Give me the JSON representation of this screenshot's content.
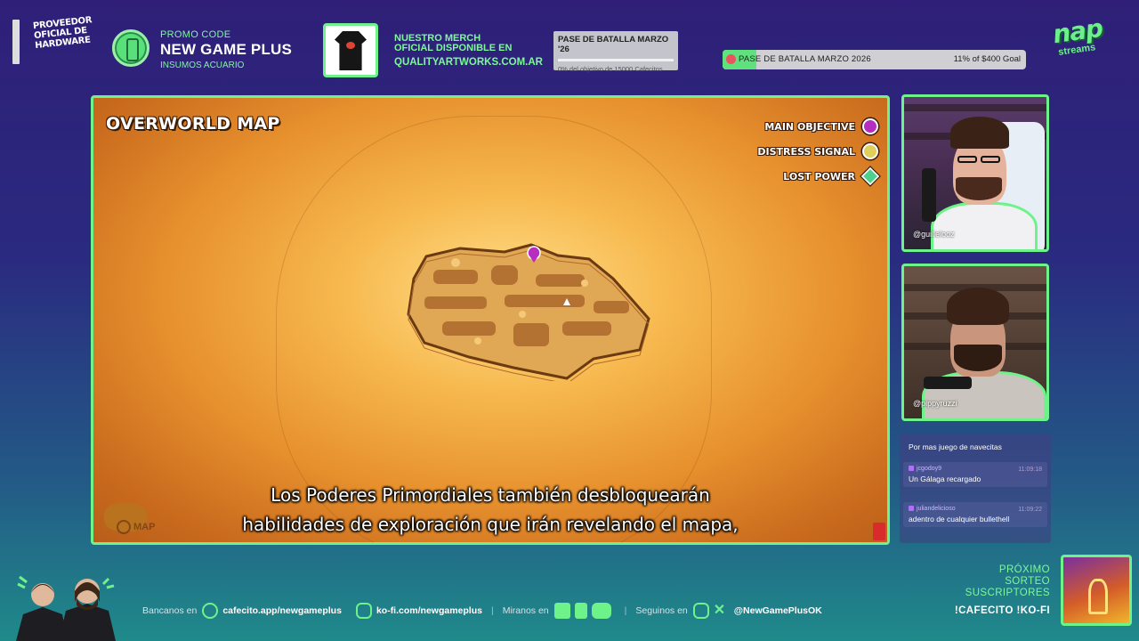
{
  "top": {
    "hardware_logo": "PROVEEDOR OFICIAL DE HARDWARE",
    "promo": {
      "label": "PROMO CODE",
      "code": "NEW GAME PLUS",
      "sub": "INSUMOS ACUARIO"
    },
    "merch": {
      "line1": "NUESTRO MERCH",
      "line2": "OFICIAL DISPONIBLE EN",
      "url": "QUALITYARTWORKS.COM.AR"
    },
    "pase_small": {
      "title": "PASE DE BATALLA MARZO '26",
      "progress_text": "0% del objetivo de 15000 Cafecitos",
      "progress": 0.0
    },
    "pase_bar": {
      "label": "PASE DE BATALLA MARZO 2026",
      "goal_text": "11% of $400 Goal",
      "progress": 0.11
    },
    "brand": {
      "name": "nap",
      "sub": "streams"
    }
  },
  "game": {
    "title": "OVERWORLD MAP",
    "legend": [
      {
        "label": "MAIN OBJECTIVE",
        "icon": "objective-icon"
      },
      {
        "label": "DISTRESS SIGNAL",
        "icon": "distress-icon"
      },
      {
        "label": "LOST POWER",
        "icon": "lost-power-icon"
      }
    ],
    "map_button": "MAP"
  },
  "subtitles": {
    "line1": "Los Poderes Primordiales también desbloquearán",
    "line2": "habilidades de exploración que irán revelando el mapa,"
  },
  "cams": [
    {
      "handle": "@guillelooz"
    },
    {
      "handle": "@pippyruzzi"
    }
  ],
  "chat": [
    {
      "user": "",
      "time": "",
      "text": "Por mas juego de navecitas"
    },
    {
      "user": "jcgodoy9",
      "time": "11:09:18",
      "text": "Un Gálaga recargado"
    },
    {
      "user": "juliandelicioso",
      "time": "11:09:22",
      "text": "adentro de cualquier bullethell"
    }
  ],
  "bottom": {
    "bancanos": "Bancanos en",
    "cafecito": "cafecito.app/newgameplus",
    "kofi": "ko-fi.com/newgameplus",
    "miranos": "Miranos en",
    "seguinos": "Seguinos en",
    "handle": "@NewGamePlusOK",
    "sep": "|"
  },
  "sorteo": {
    "l1": "PRÓXIMO",
    "l2": "SORTEO",
    "l3": "SUSCRIPTORES",
    "cmd": "!CAFECITO  !KO-FI"
  },
  "colors": {
    "accent": "#6ef38b",
    "accent_text": "#7ef89a",
    "bg_top": "#2f1f78",
    "bg_bottom": "#1f8a8a"
  }
}
